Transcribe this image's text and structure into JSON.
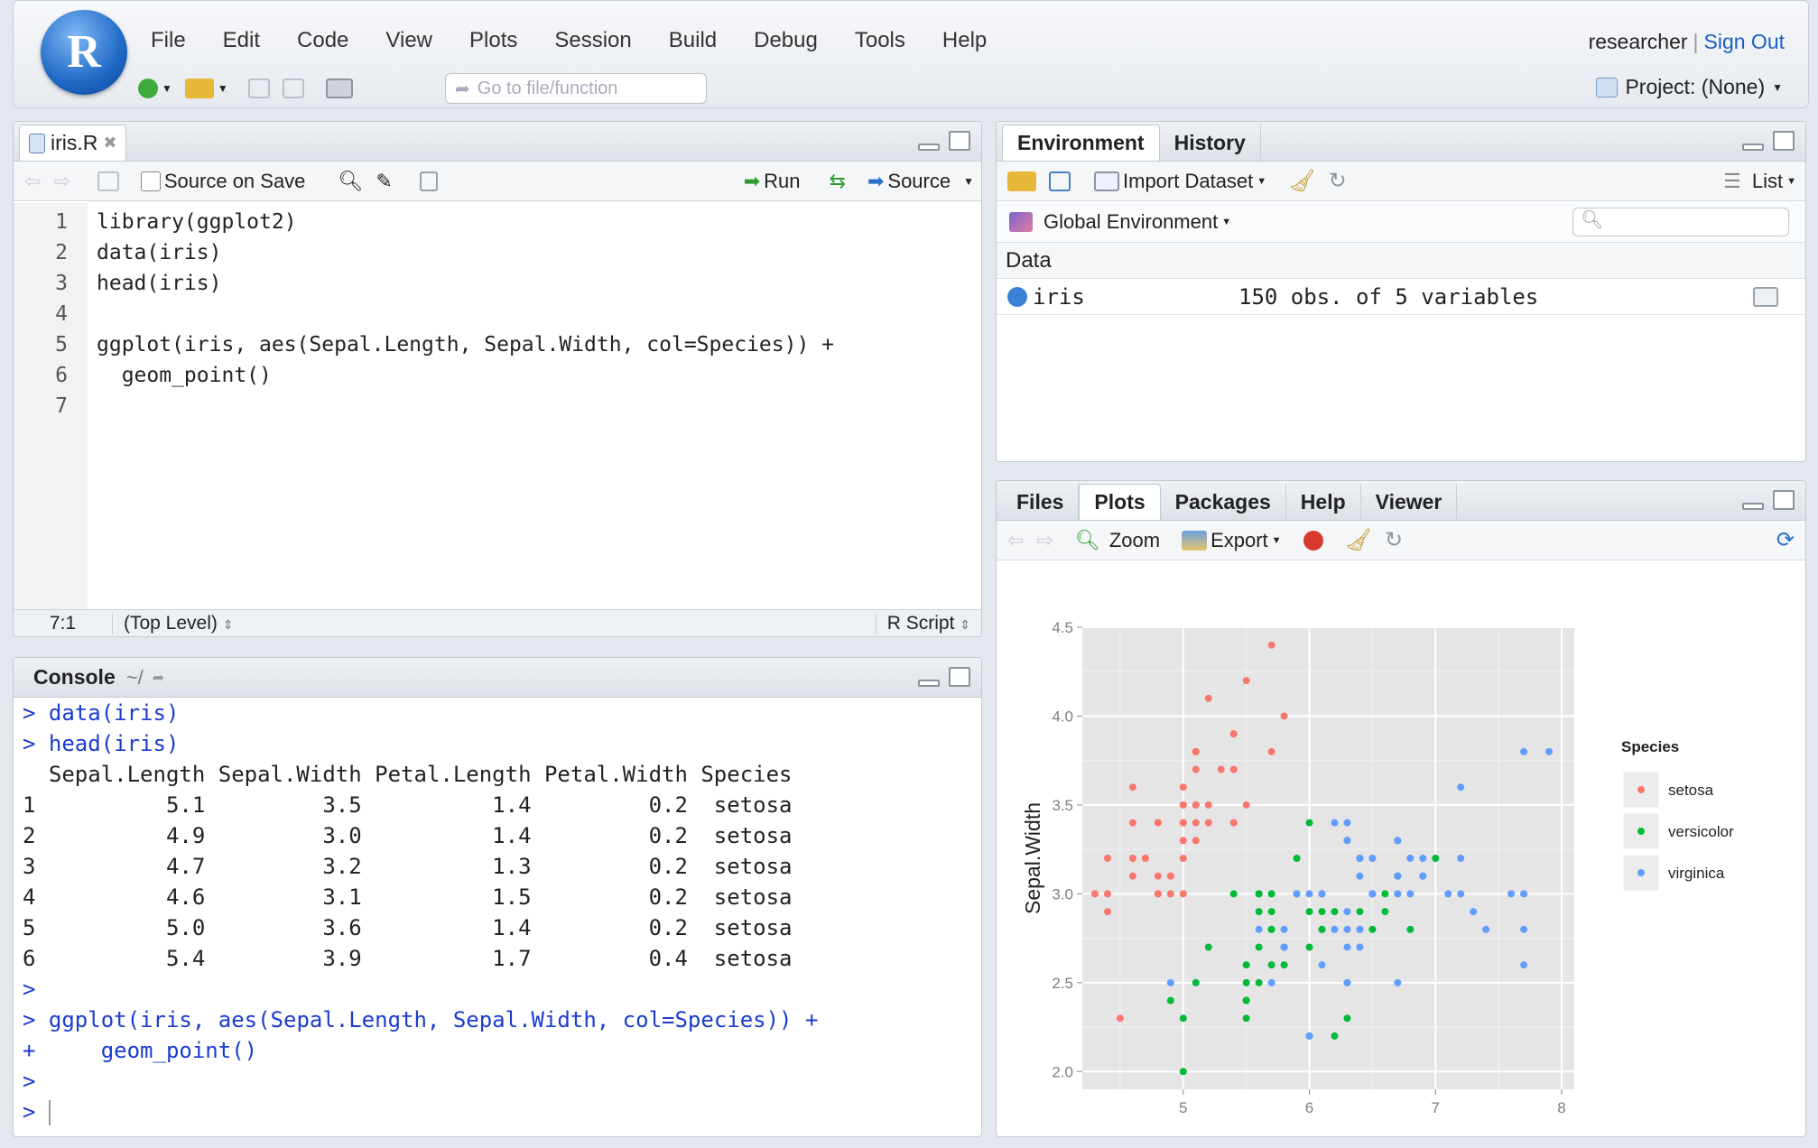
{
  "menubar": {
    "items": [
      "File",
      "Edit",
      "Code",
      "View",
      "Plots",
      "Session",
      "Build",
      "Debug",
      "Tools",
      "Help"
    ],
    "user": "researcher",
    "sign_out": "Sign Out",
    "goto_placeholder": "Go to file/function",
    "project": "Project: (None)"
  },
  "editor": {
    "tab_label": "iris.R",
    "source_on_save": "Source on Save",
    "run_label": "Run",
    "source_label": "Source",
    "lines": [
      {
        "num": "1",
        "text": "library(ggplot2)"
      },
      {
        "num": "2",
        "text": "data(iris)"
      },
      {
        "num": "3",
        "text": "head(iris)"
      },
      {
        "num": "4",
        "text": ""
      },
      {
        "num": "5",
        "text": "ggplot(iris, aes(Sepal.Length, Sepal.Width, col=Species)) +"
      },
      {
        "num": "6",
        "text": "  geom_point()"
      },
      {
        "num": "7",
        "text": ""
      }
    ],
    "cursor_pos": "7:1",
    "scope": "(Top Level)",
    "file_type": "R Script"
  },
  "console": {
    "title": "Console",
    "path": "~/",
    "lines": [
      {
        "prompt": ">",
        "text": " data(iris)",
        "cls": "blue"
      },
      {
        "prompt": ">",
        "text": " head(iris)",
        "cls": "blue"
      },
      {
        "prompt": "",
        "text": "  Sepal.Length Sepal.Width Petal.Length Petal.Width Species",
        "cls": ""
      },
      {
        "prompt": "",
        "text": "1          5.1         3.5          1.4         0.2  setosa",
        "cls": ""
      },
      {
        "prompt": "",
        "text": "2          4.9         3.0          1.4         0.2  setosa",
        "cls": ""
      },
      {
        "prompt": "",
        "text": "3          4.7         3.2          1.3         0.2  setosa",
        "cls": ""
      },
      {
        "prompt": "",
        "text": "4          4.6         3.1          1.5         0.2  setosa",
        "cls": ""
      },
      {
        "prompt": "",
        "text": "5          5.0         3.6          1.4         0.2  setosa",
        "cls": ""
      },
      {
        "prompt": "",
        "text": "6          5.4         3.9          1.7         0.4  setosa",
        "cls": ""
      },
      {
        "prompt": ">",
        "text": "",
        "cls": "blue"
      },
      {
        "prompt": ">",
        "text": " ggplot(iris, aes(Sepal.Length, Sepal.Width, col=Species)) +",
        "cls": "blue"
      },
      {
        "prompt": "+",
        "text": "     geom_point()",
        "cls": "blue"
      },
      {
        "prompt": ">",
        "text": "",
        "cls": "blue"
      },
      {
        "prompt": ">",
        "text": " ",
        "cls": "blue"
      }
    ]
  },
  "environment": {
    "tabs": [
      "Environment",
      "History"
    ],
    "import_dataset": "Import Dataset",
    "list_label": "List",
    "scope": "Global Environment",
    "section": "Data",
    "rows": [
      {
        "name": "iris",
        "value": "150 obs. of 5 variables"
      }
    ]
  },
  "plots_pane": {
    "tabs": [
      "Files",
      "Plots",
      "Packages",
      "Help",
      "Viewer"
    ],
    "zoom_label": "Zoom",
    "export_label": "Export"
  },
  "chart_data": {
    "type": "scatter",
    "xlabel": "Sepal.Length",
    "ylabel": "Sepal.Width",
    "xlim": [
      4.2,
      8.1
    ],
    "ylim": [
      1.9,
      4.5
    ],
    "xticks": [
      5,
      6,
      7,
      8
    ],
    "yticks": [
      2.0,
      2.5,
      3.0,
      3.5,
      4.0,
      4.5
    ],
    "grid": true,
    "legend_title": "Species",
    "legend_position": "right",
    "series": [
      {
        "name": "setosa",
        "color": "#f8766d",
        "points": [
          [
            5.1,
            3.5
          ],
          [
            4.9,
            3.0
          ],
          [
            4.7,
            3.2
          ],
          [
            4.6,
            3.1
          ],
          [
            5.0,
            3.6
          ],
          [
            5.4,
            3.9
          ],
          [
            4.6,
            3.4
          ],
          [
            5.0,
            3.4
          ],
          [
            4.4,
            2.9
          ],
          [
            4.9,
            3.1
          ],
          [
            5.4,
            3.7
          ],
          [
            4.8,
            3.4
          ],
          [
            4.8,
            3.0
          ],
          [
            4.3,
            3.0
          ],
          [
            5.8,
            4.0
          ],
          [
            5.7,
            4.4
          ],
          [
            5.4,
            3.9
          ],
          [
            5.1,
            3.5
          ],
          [
            5.7,
            3.8
          ],
          [
            5.1,
            3.8
          ],
          [
            5.4,
            3.4
          ],
          [
            5.1,
            3.7
          ],
          [
            4.6,
            3.6
          ],
          [
            5.1,
            3.3
          ],
          [
            4.8,
            3.4
          ],
          [
            5.0,
            3.0
          ],
          [
            5.0,
            3.4
          ],
          [
            5.2,
            3.5
          ],
          [
            5.2,
            3.4
          ],
          [
            4.7,
            3.2
          ],
          [
            4.8,
            3.1
          ],
          [
            5.4,
            3.4
          ],
          [
            5.2,
            4.1
          ],
          [
            5.5,
            4.2
          ],
          [
            4.9,
            3.1
          ],
          [
            5.0,
            3.2
          ],
          [
            5.5,
            3.5
          ],
          [
            4.4,
            3.0
          ],
          [
            5.1,
            3.4
          ],
          [
            5.0,
            3.5
          ],
          [
            4.5,
            2.3
          ],
          [
            4.4,
            3.2
          ],
          [
            5.0,
            3.5
          ],
          [
            5.1,
            3.8
          ],
          [
            4.8,
            3.0
          ],
          [
            5.1,
            3.8
          ],
          [
            4.6,
            3.2
          ],
          [
            5.3,
            3.7
          ],
          [
            5.0,
            3.3
          ]
        ]
      },
      {
        "name": "versicolor",
        "color": "#00ba38",
        "points": [
          [
            7.0,
            3.2
          ],
          [
            6.4,
            3.2
          ],
          [
            6.9,
            3.1
          ],
          [
            5.5,
            2.3
          ],
          [
            6.5,
            2.8
          ],
          [
            5.7,
            2.8
          ],
          [
            6.3,
            3.3
          ],
          [
            4.9,
            2.4
          ],
          [
            6.6,
            2.9
          ],
          [
            5.2,
            2.7
          ],
          [
            5.0,
            2.0
          ],
          [
            5.9,
            3.0
          ],
          [
            6.0,
            2.2
          ],
          [
            6.1,
            2.9
          ],
          [
            5.6,
            2.9
          ],
          [
            6.7,
            3.1
          ],
          [
            5.6,
            3.0
          ],
          [
            5.8,
            2.7
          ],
          [
            6.2,
            2.2
          ],
          [
            5.6,
            2.5
          ],
          [
            5.9,
            3.2
          ],
          [
            6.1,
            2.8
          ],
          [
            6.3,
            2.5
          ],
          [
            6.1,
            2.8
          ],
          [
            6.4,
            2.9
          ],
          [
            6.6,
            3.0
          ],
          [
            6.8,
            2.8
          ],
          [
            6.7,
            3.0
          ],
          [
            6.0,
            2.9
          ],
          [
            5.7,
            2.6
          ],
          [
            5.5,
            2.4
          ],
          [
            5.5,
            2.4
          ],
          [
            5.8,
            2.7
          ],
          [
            6.0,
            2.7
          ],
          [
            5.4,
            3.0
          ],
          [
            6.0,
            3.4
          ],
          [
            6.7,
            3.1
          ],
          [
            6.3,
            2.3
          ],
          [
            5.6,
            3.0
          ],
          [
            5.5,
            2.5
          ],
          [
            5.5,
            2.6
          ],
          [
            6.1,
            3.0
          ],
          [
            5.8,
            2.6
          ],
          [
            5.0,
            2.3
          ],
          [
            5.6,
            2.7
          ],
          [
            5.7,
            3.0
          ],
          [
            5.7,
            2.9
          ],
          [
            6.2,
            2.9
          ],
          [
            5.1,
            2.5
          ],
          [
            5.7,
            2.8
          ]
        ]
      },
      {
        "name": "virginica",
        "color": "#619cff",
        "points": [
          [
            6.3,
            3.3
          ],
          [
            5.8,
            2.7
          ],
          [
            7.1,
            3.0
          ],
          [
            6.3,
            2.9
          ],
          [
            6.5,
            3.0
          ],
          [
            7.6,
            3.0
          ],
          [
            4.9,
            2.5
          ],
          [
            7.3,
            2.9
          ],
          [
            6.7,
            2.5
          ],
          [
            7.2,
            3.6
          ],
          [
            6.5,
            3.2
          ],
          [
            6.4,
            2.7
          ],
          [
            6.8,
            3.0
          ],
          [
            5.7,
            2.5
          ],
          [
            5.8,
            2.8
          ],
          [
            6.4,
            3.2
          ],
          [
            6.5,
            3.0
          ],
          [
            7.7,
            3.8
          ],
          [
            7.7,
            2.6
          ],
          [
            6.0,
            2.2
          ],
          [
            6.9,
            3.2
          ],
          [
            5.6,
            2.8
          ],
          [
            7.7,
            2.8
          ],
          [
            6.3,
            2.7
          ],
          [
            6.7,
            3.3
          ],
          [
            7.2,
            3.2
          ],
          [
            6.2,
            2.8
          ],
          [
            6.1,
            3.0
          ],
          [
            6.4,
            2.8
          ],
          [
            7.2,
            3.0
          ],
          [
            7.4,
            2.8
          ],
          [
            7.9,
            3.8
          ],
          [
            6.4,
            2.8
          ],
          [
            6.3,
            2.8
          ],
          [
            6.1,
            2.6
          ],
          [
            7.7,
            3.0
          ],
          [
            6.3,
            3.4
          ],
          [
            6.4,
            3.1
          ],
          [
            6.0,
            3.0
          ],
          [
            6.9,
            3.1
          ],
          [
            6.7,
            3.1
          ],
          [
            6.9,
            3.1
          ],
          [
            5.8,
            2.7
          ],
          [
            6.8,
            3.2
          ],
          [
            6.7,
            3.3
          ],
          [
            6.7,
            3.0
          ],
          [
            6.3,
            2.5
          ],
          [
            6.5,
            3.0
          ],
          [
            6.2,
            3.4
          ],
          [
            5.9,
            3.0
          ]
        ]
      }
    ]
  }
}
